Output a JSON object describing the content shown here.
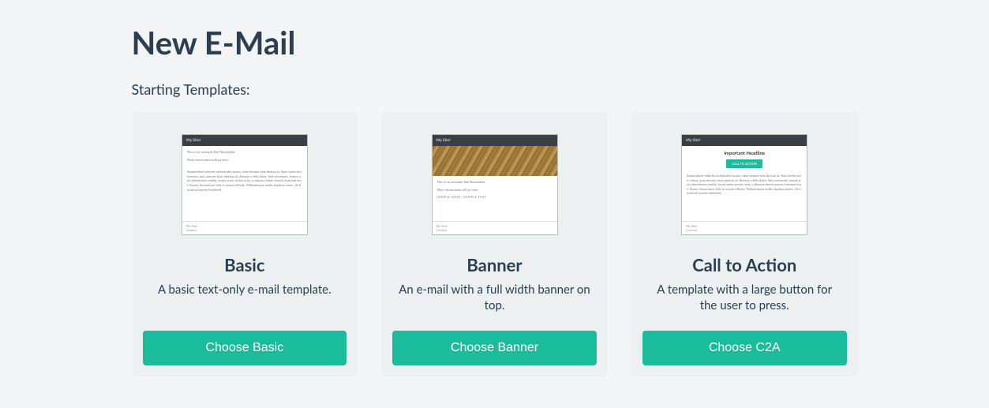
{
  "page_title": "New E-Mail",
  "subtitle": "Starting Templates:",
  "preview_common": {
    "header": "My Site!",
    "intro": "This is my example Site Newsletter.",
    "info_line": "More information will go here.",
    "lorem": "Suspendisse lobortis molestudes quam, vitae tempor erat dictum at. Nam turbo lecin metus, quis almuen risus egestas id. Aenean a felis dolor. Sed commodo, neque quis elementum mattis, turpis enim auctor urna, a aliquam lorem mauris euismod erat. Donec fermentum felis in ornare efficitu. Pellentesque mollis dapibus lorem. Ut tincidunt laoreet hendrerit.",
    "sample_row": "SAMPLE DATA | SAMPLE TEXT",
    "c2a_headline": "Important Headline",
    "c2a_btn": "CALL TO ACTION",
    "footer_name": "My Site!",
    "footer_contact": "Contact"
  },
  "templates": [
    {
      "title": "Basic",
      "description": "A basic text-only e-mail template.",
      "button": "Choose Basic"
    },
    {
      "title": "Banner",
      "description": "An e-mail with a full width banner on top.",
      "button": "Choose Banner"
    },
    {
      "title": "Call to Action",
      "description": "A template with a large button for the user to press.",
      "button": "Choose C2A"
    }
  ]
}
